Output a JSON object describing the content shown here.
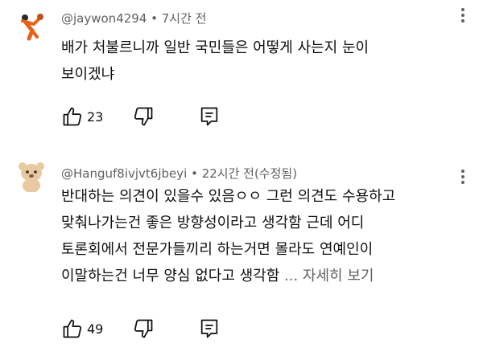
{
  "comments": [
    {
      "author": "@jaywon4294",
      "time": "7시간 전",
      "text_lines": [
        "배가 처불르니까 일반 국민들은 어떻게 사는지 눈이",
        "보이겠냐"
      ],
      "likes": "23"
    },
    {
      "author": "@Hanguf8ivjvt6jbeyi",
      "time": "22시간 전(수정됨)",
      "text_lines": [
        "반대하는 의견이 있을수 있음ㅇㅇ 그런 의견도 수용하고",
        "맞춰나가는건 좋은 방향성이라고 생각함 근데 어디",
        "토론회에서 전문가들끼리 하는거면 몰라도 연예인이",
        "이말하는건 너무 양심 없다고 생각함"
      ],
      "more_label": "... 자세히 보기",
      "likes": "49"
    }
  ],
  "separator": " • ",
  "icons": {
    "avatar_1": "basketball-player-avatar",
    "avatar_2": "bear-avatar",
    "like": "thumb-up-icon",
    "dislike": "thumb-down-icon",
    "reply": "reply-icon",
    "menu": "more-vert-icon"
  },
  "colors": {
    "text": "#0f0f0f",
    "secondary_text": "#606060",
    "avatar_1_accent": "#e8601a",
    "avatar_2_fur": "#e9c9a2"
  }
}
